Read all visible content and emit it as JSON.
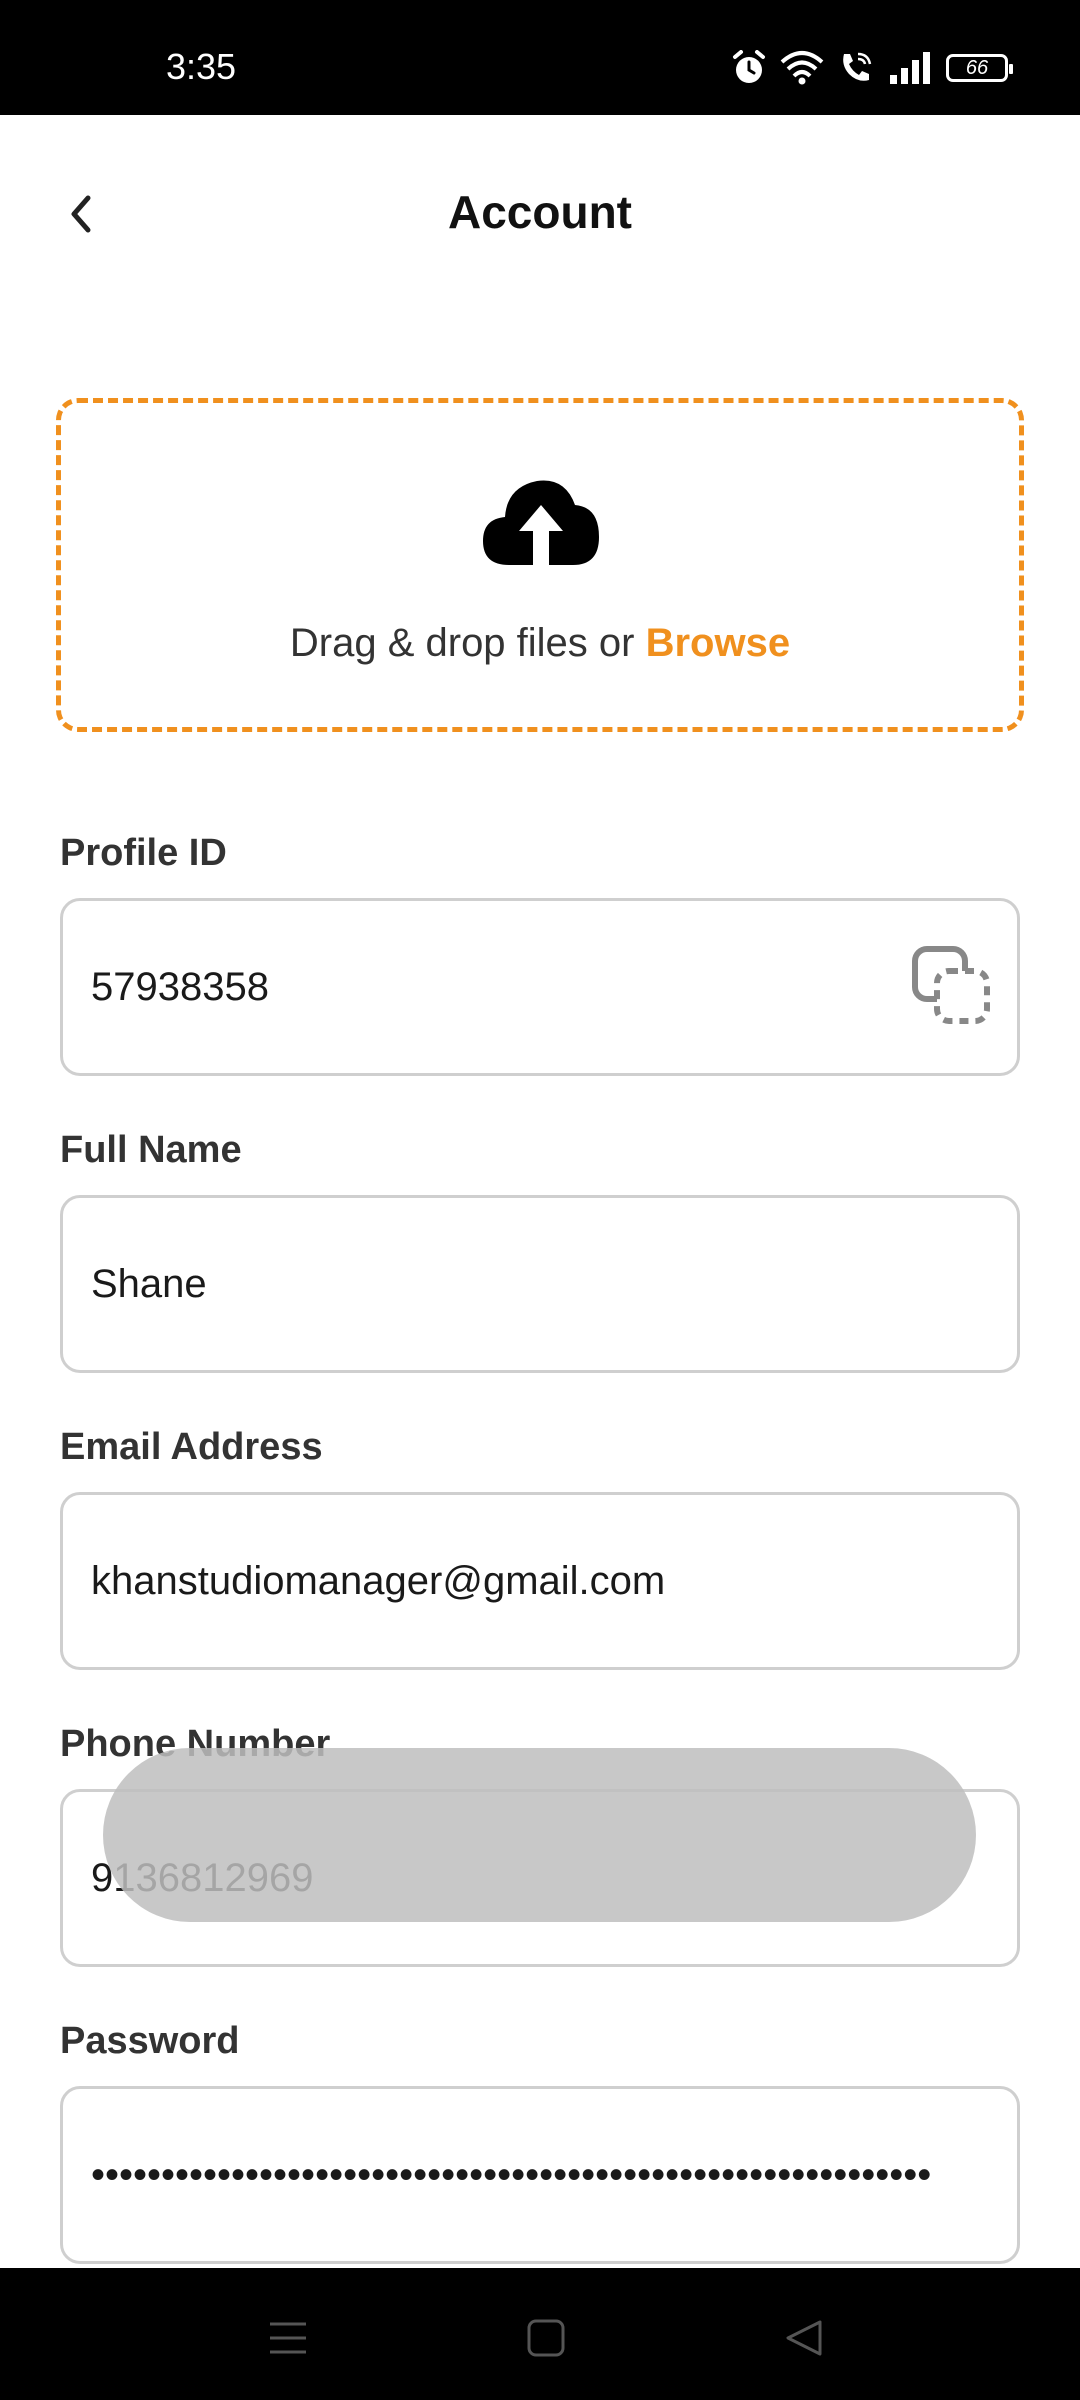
{
  "status_bar": {
    "time": "3:35",
    "battery": "66",
    "icons": [
      "alarm-icon",
      "wifi-icon",
      "wifi-calling-icon",
      "signal-icon",
      "battery-icon"
    ]
  },
  "header": {
    "title": "Account",
    "back_icon": "chevron-left-icon"
  },
  "upload": {
    "icon": "cloud-upload-icon",
    "text": "Drag & drop files or ",
    "browse_label": "Browse"
  },
  "form": {
    "profile_id": {
      "label": "Profile ID",
      "value": "57938358",
      "action_icon": "copy-icon"
    },
    "full_name": {
      "label": "Full Name",
      "value": "Shane"
    },
    "email": {
      "label": "Email Address",
      "value": "khanstudiomanager@gmail.com"
    },
    "phone": {
      "label": "Phone Number",
      "value": "9136812969"
    },
    "password": {
      "label": "Password",
      "value": "••••••••••••••••••••••••••••••••••••••••••••••••••••••••••••"
    }
  },
  "nav_bar": {
    "icons": [
      "menu-icon",
      "home-icon",
      "back-icon"
    ]
  },
  "colors": {
    "accent": "#F0901E",
    "border": "#cfcfcf",
    "status_bar": "#000000"
  }
}
